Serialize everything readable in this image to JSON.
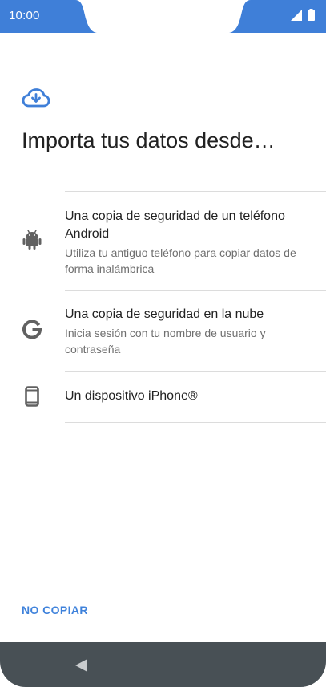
{
  "status_bar": {
    "time": "10:00",
    "accent_color": "#3f7fd8",
    "icons": [
      "signal-icon",
      "battery-icon"
    ]
  },
  "header": {
    "icon": "cloud-download-icon",
    "title": "Importa tus datos desde…"
  },
  "options": [
    {
      "icon": "android-icon",
      "title": "Una copia de seguridad de un teléfono Android",
      "subtitle": "Utiliza tu antiguo teléfono para copiar datos de forma inalámbrica"
    },
    {
      "icon": "google-icon",
      "title": "Una copia de seguridad en la nube",
      "subtitle": "Inicia sesión con tu nombre de usuario y contraseña"
    },
    {
      "icon": "phone-icon",
      "title": "Un dispositivo iPhone®",
      "subtitle": ""
    }
  ],
  "footer": {
    "skip_label": "NO COPIAR",
    "accent_color": "#3f82db"
  },
  "nav_bar": {
    "icon": "back-triangle-icon",
    "color": "#485055"
  }
}
